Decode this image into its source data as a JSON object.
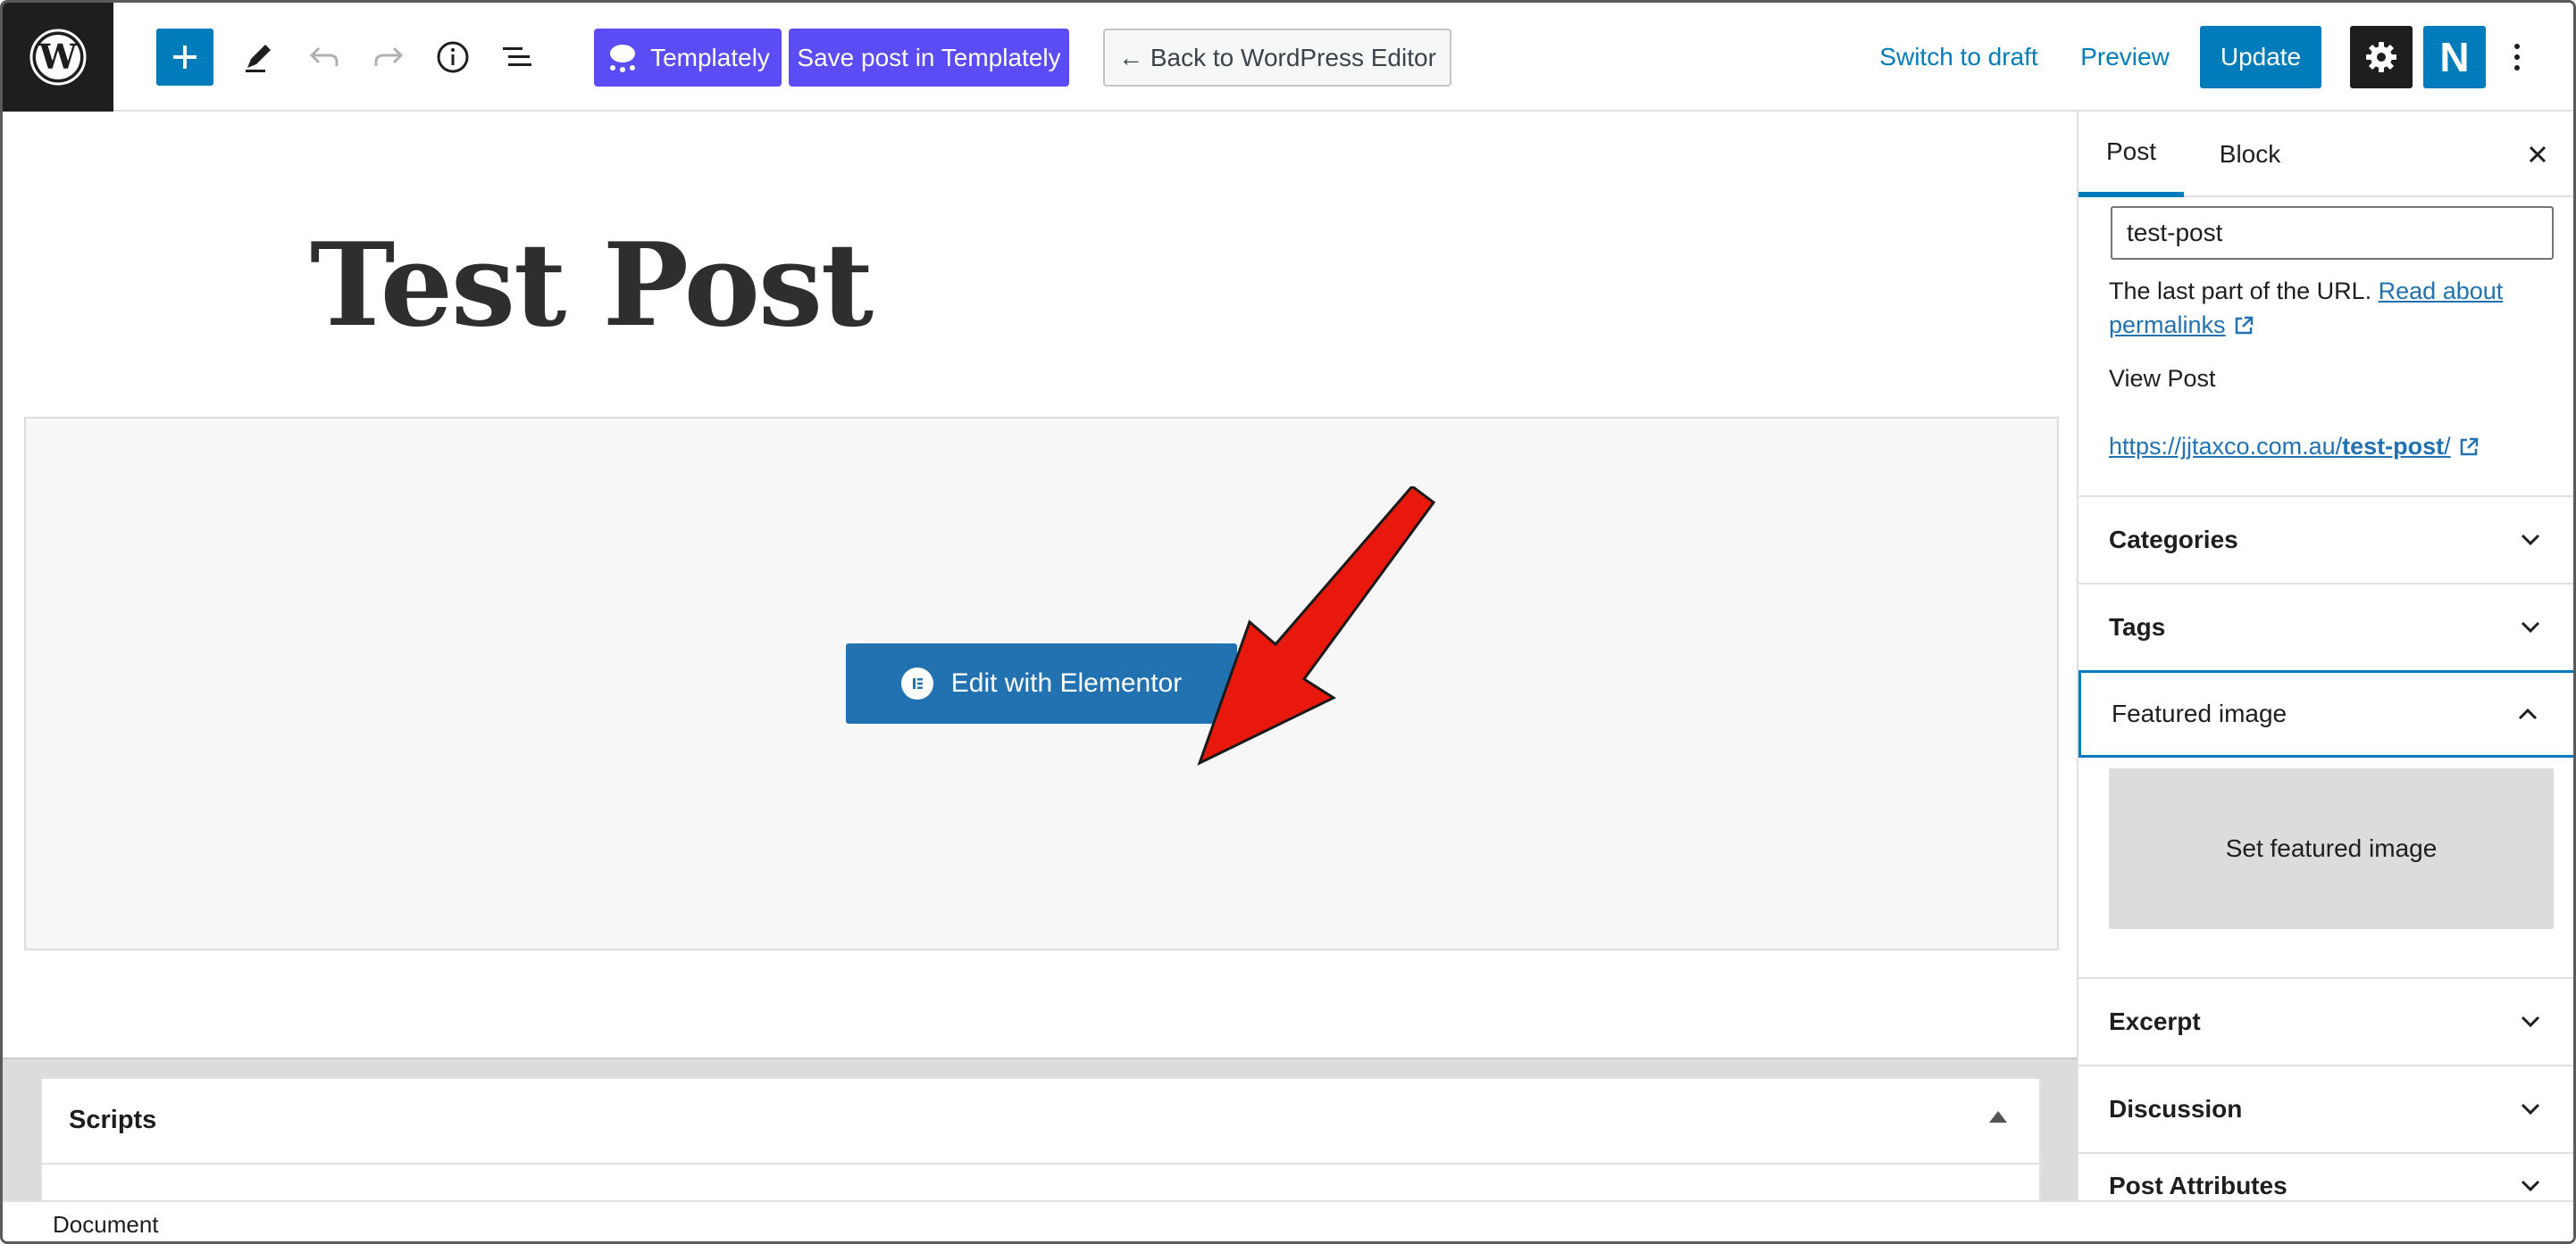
{
  "toolbar": {
    "templately_label": "Templately",
    "save_templately_label": "Save post in Templately",
    "back_label": "← Back to WordPress Editor",
    "switch_draft_label": "Switch to draft",
    "preview_label": "Preview",
    "update_label": "Update",
    "n_plugin_label": "N"
  },
  "canvas": {
    "post_title": "Test Post",
    "elementor_button_label": "Edit with Elementor"
  },
  "metaboxes": {
    "scripts_title": "Scripts"
  },
  "footer": {
    "breadcrumb": "Document"
  },
  "sidebar": {
    "tabs": [
      {
        "label": "Post"
      },
      {
        "label": "Block"
      }
    ],
    "slug_value": "test-post",
    "slug_help_text": "The last part of the URL. ",
    "permalinks_link": "Read about permalinks",
    "view_post_label": "View Post",
    "view_post_url_prefix": "https://jjtaxco.com.au/",
    "view_post_url_slug": "test-post",
    "view_post_url_suffix": "/",
    "panels": [
      {
        "title": "Categories"
      },
      {
        "title": "Tags"
      },
      {
        "title": "Featured image"
      },
      {
        "title": "Excerpt"
      },
      {
        "title": "Discussion"
      },
      {
        "title": "Post Attributes"
      }
    ],
    "set_featured_image_label": "Set featured image"
  },
  "colors": {
    "accent": "#007cba",
    "templately": "#5b4cf5",
    "elementor_button": "#2271b1",
    "annotation_arrow": "#e8190c"
  }
}
